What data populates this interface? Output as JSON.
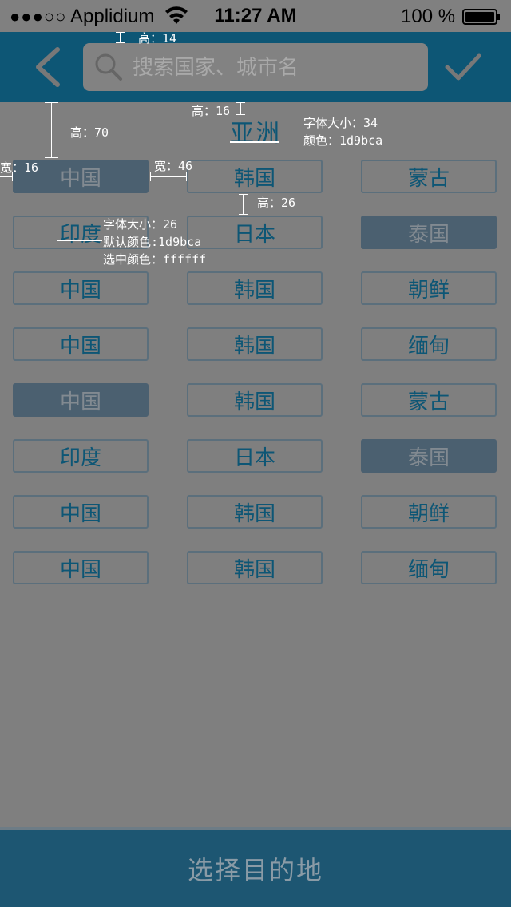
{
  "status_bar": {
    "carrier": "Applidium",
    "time": "11:27 AM",
    "battery_percent": "100 %",
    "signal_dots": "●●●○○"
  },
  "navbar": {
    "search_placeholder": "搜索国家、城市名",
    "back_icon": "chevron-left-icon",
    "search_icon": "search-icon",
    "confirm_icon": "checkmark-icon",
    "background_color": "#0d5675"
  },
  "continent": {
    "title": "亚洲",
    "color": "#1d9bca"
  },
  "countries": [
    {
      "label": "中国",
      "selected": true
    },
    {
      "label": "韩国",
      "selected": false
    },
    {
      "label": "蒙古",
      "selected": false
    },
    {
      "label": "印度",
      "selected": false
    },
    {
      "label": "日本",
      "selected": false
    },
    {
      "label": "泰国",
      "selected": true
    },
    {
      "label": "中国",
      "selected": false
    },
    {
      "label": "韩国",
      "selected": false
    },
    {
      "label": "朝鲜",
      "selected": false
    },
    {
      "label": "中国",
      "selected": false
    },
    {
      "label": "韩国",
      "selected": false
    },
    {
      "label": "缅甸",
      "selected": false
    },
    {
      "label": "中国",
      "selected": true
    },
    {
      "label": "韩国",
      "selected": false
    },
    {
      "label": "蒙古",
      "selected": false
    },
    {
      "label": "印度",
      "selected": false
    },
    {
      "label": "日本",
      "selected": false
    },
    {
      "label": "泰国",
      "selected": true
    },
    {
      "label": "中国",
      "selected": false
    },
    {
      "label": "韩国",
      "selected": false
    },
    {
      "label": "朝鲜",
      "selected": false
    },
    {
      "label": "中国",
      "selected": false
    },
    {
      "label": "韩国",
      "selected": false
    },
    {
      "label": "缅甸",
      "selected": false
    }
  ],
  "annotations": {
    "search_height": "高：14",
    "title_gap": "高：16",
    "header_height": "高：70",
    "title_font": "字体大小：34",
    "title_color": "颜色：1d9bca",
    "left_margin": "宽：16",
    "col_gap": "宽：46",
    "row_gap": "高：26",
    "btn_font": "字体大小：26",
    "btn_default_color": "默认颜色:1d9bca",
    "btn_selected_color": "选中颜色：ffffff"
  },
  "footer": {
    "label": "选择目的地"
  }
}
